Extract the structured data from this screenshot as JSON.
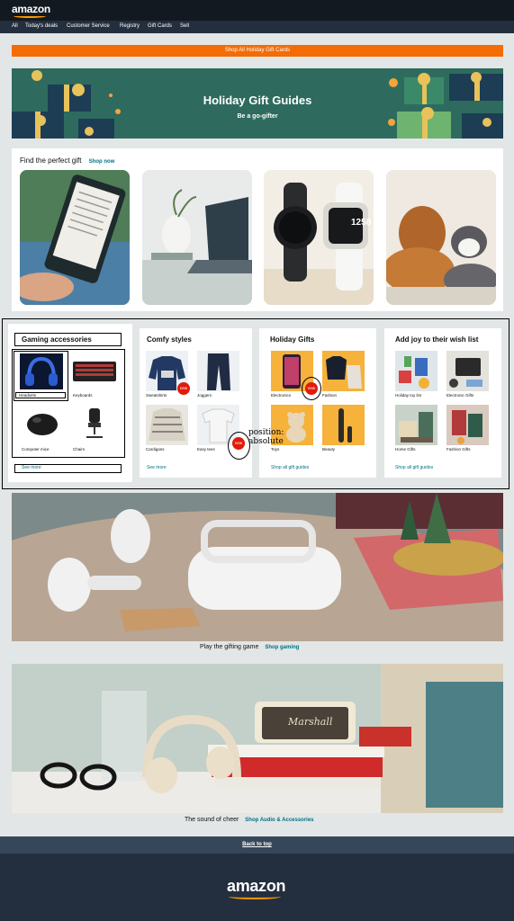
{
  "header": {
    "logo_text": "amazon"
  },
  "nav": {
    "items": [
      "All",
      "Today's deals",
      "Customer Service",
      "Registry",
      "Gift Cards",
      "Sell"
    ]
  },
  "promo_bar": {
    "label": "Shop All Holiday Gift Cards"
  },
  "hero": {
    "title": "Holiday Gift Guides",
    "subtitle": "Be a go-gifter"
  },
  "perfect_gift": {
    "title": "Find the perfect gift",
    "link": "Shop now",
    "tiles": [
      {
        "icon": "e-reader-image"
      },
      {
        "icon": "laptop-desk-image"
      },
      {
        "icon": "smartwatch-image"
      },
      {
        "icon": "dog-and-cat-image"
      }
    ],
    "watch_reading": "1258"
  },
  "gaming": {
    "title": "Gaming accessories",
    "items": [
      "Headsets",
      "Keyboards",
      "Computer mice",
      "Chairs"
    ],
    "more": "See more"
  },
  "comfy": {
    "title": "Comfy styles",
    "items": [
      "Sweatshirts",
      "Joggers",
      "Cardigans",
      "Easy tees"
    ],
    "more": "See more",
    "badge": "new"
  },
  "holiday_gifts": {
    "title": "Holiday Gifts",
    "items": [
      "Electronics",
      "Fashion",
      "Toys",
      "Beauty"
    ],
    "more": "Shop all gift guides",
    "badge": "new"
  },
  "wishlist": {
    "title": "Add joy to their wish list",
    "items": [
      "Holiday toy list",
      "Electronic Gifts",
      "Home Gifts",
      "Fashion Gifts"
    ],
    "more": "Shop all gift guides"
  },
  "annotation": {
    "line1": "position:",
    "line2": "absolute"
  },
  "gaming_promo": {
    "text": "Play the gifting game",
    "link": "Shop gaming"
  },
  "audio_promo": {
    "text": "The sound of cheer",
    "link": "Shop Audio & Accessories",
    "brand": "Marshall"
  },
  "back_to_top": "Back to top",
  "footer": {
    "logo_text": "amazon"
  },
  "colors": {
    "header": "#131921",
    "nav": "#232f3e",
    "accent": "#f36c05",
    "link": "#007185",
    "hero": "#2e6b5e",
    "badge": "#e21a0b"
  }
}
